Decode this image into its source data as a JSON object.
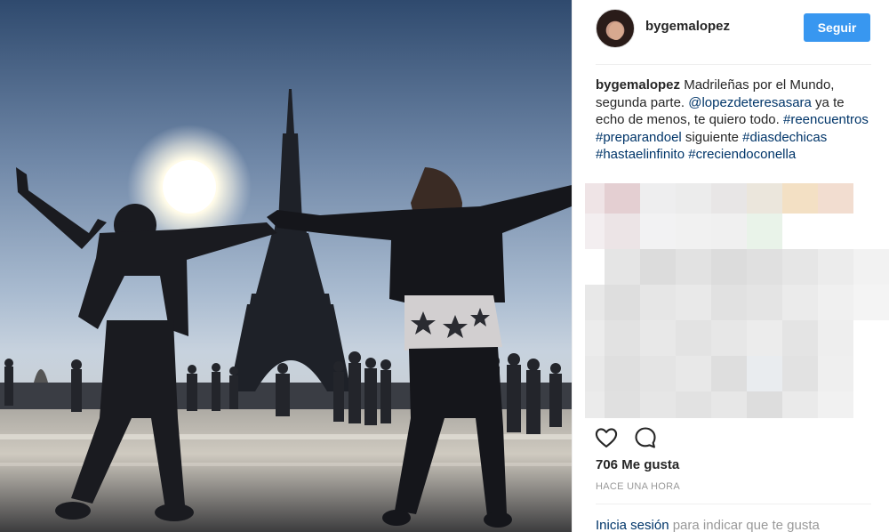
{
  "post": {
    "username": "bygemalopez",
    "follow_label": "Seguir",
    "caption": {
      "author": "bygemalopez",
      "text_1": " Madrileñas por el Mundo, segunda parte. ",
      "mention": "@lopezdeteresasara",
      "text_2": " ya te echo de menos, te quiero todo. ",
      "tag_1": "#reencuentros",
      "tag_2": "#preparandoel",
      "text_3": " siguiente ",
      "tag_3": "#diasdechicas",
      "tag_4": "#hastaelinfinito",
      "tag_5": "#creciendoconella"
    },
    "likes": "706 Me gusta",
    "time": "HACE UNA HORA",
    "login_link": "Inicia sesión",
    "login_rest": " para indicar que te gusta"
  },
  "colors": {
    "follow_button": "#3897f0",
    "link": "#003569",
    "muted": "#999999"
  },
  "icons": {
    "like": "heart-outline-icon",
    "comment": "speech-bubble-icon"
  }
}
